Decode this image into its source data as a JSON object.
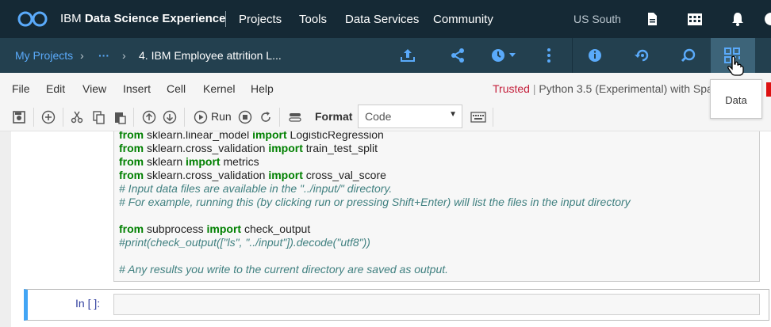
{
  "header": {
    "brand_prefix": "IBM",
    "brand_name": "Data Science Experience",
    "nav": [
      "Projects",
      "Tools",
      "Data Services",
      "Community"
    ],
    "region": "US South",
    "icons": [
      "document-icon",
      "grid-building-icon",
      "bell-icon",
      "user-icon"
    ]
  },
  "breadcrumb": {
    "root": "My Projects",
    "sep": "›",
    "ellipsis": "···",
    "current": "4. IBM Employee attrition L..."
  },
  "subbar_icons": [
    "export-icon",
    "share-icon",
    "schedule-icon",
    "more-vertical-icon",
    "info-icon",
    "version-history-icon",
    "collaborate-icon",
    "data-icon"
  ],
  "menu": {
    "items": [
      "File",
      "Edit",
      "View",
      "Insert",
      "Cell",
      "Kernel",
      "Help"
    ],
    "trusted": "Trusted",
    "kernel": "Python 3.5 (Experimental) with Spa"
  },
  "toolbar": {
    "run_label": "Run",
    "format_label": "Format",
    "cell_type": "Code"
  },
  "tooltip": {
    "text": "Data"
  },
  "code": {
    "lines": [
      {
        "kw1": "from",
        "t1": " sklearn.linear_model ",
        "kw2": "import",
        "t2": " LogisticRegression"
      },
      {
        "kw1": "from",
        "t1": " sklearn.cross_validation ",
        "kw2": "import",
        "t2": " train_test_split"
      },
      {
        "kw1": "from",
        "t1": " sklearn ",
        "kw2": "import",
        "t2": " metrics"
      },
      {
        "kw1": "from",
        "t1": " sklearn.cross_validation ",
        "kw2": "import",
        "t2": " cross_val_score"
      }
    ],
    "comment1": "# Input data files are available in the \"../input/\" directory.",
    "comment2": "# For example, running this (by clicking run or pressing Shift+Enter) will list the files in the input directory",
    "subprocess": {
      "kw1": "from",
      "t1": " subprocess ",
      "kw2": "import",
      "t2": " check_output"
    },
    "comment3": "#print(check_output([\"ls\", \"../input\"]).decode(\"utf8\"))",
    "comment4": "# Any results you write to the current directory are saved as output."
  },
  "new_cell": {
    "prompt": "In [ ]:"
  }
}
